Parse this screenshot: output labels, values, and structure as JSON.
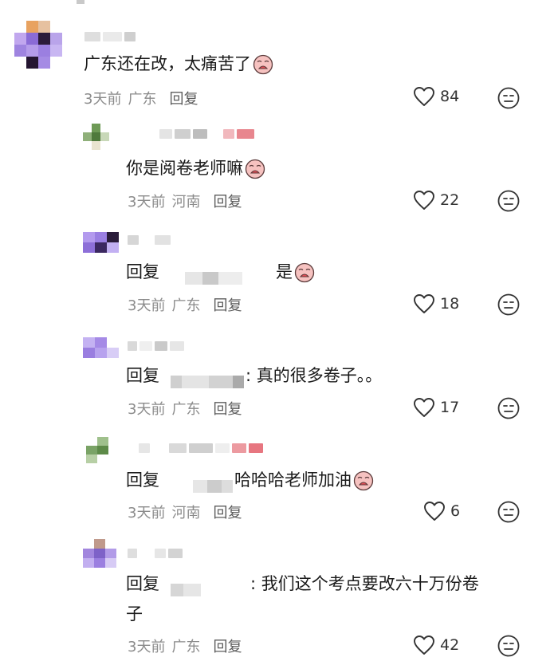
{
  "comments": [
    {
      "text": "广东还在改，太痛苦了",
      "time": "3天前",
      "location": "广东",
      "reply_label": "回复",
      "likes": "84"
    },
    {
      "text": "你是阅卷老师嘛",
      "time": "3天前",
      "location": "河南",
      "reply_label": "回复",
      "likes": "22"
    },
    {
      "prefix": "回复",
      "text": "是",
      "time": "3天前",
      "location": "广东",
      "reply_label": "回复",
      "likes": "18"
    },
    {
      "prefix": "回复",
      "text": ": 真的很多卷子。。",
      "time": "3天前",
      "location": "广东",
      "reply_label": "回复",
      "likes": "17"
    },
    {
      "prefix": "回复",
      "text": "哈哈哈老师加油",
      "time": "3天前",
      "location": "河南",
      "reply_label": "回复",
      "likes": "6"
    },
    {
      "prefix": "回复",
      "text": ": 我们这个考点要改六十万份卷",
      "text_line2": "子",
      "time": "3天前",
      "location": "广东",
      "reply_label": "回复",
      "likes": "42"
    }
  ],
  "icons": {
    "like": "heart-outline-icon",
    "dislike": "meh-face-icon",
    "emoji": "crying-face-emoji"
  },
  "colors": {
    "text": "#1a1a1a",
    "meta": "#8b8b8b",
    "icon": "#333333",
    "pixelate_purple": "#a98ee0",
    "pixelate_pink": "#ec7b86"
  }
}
